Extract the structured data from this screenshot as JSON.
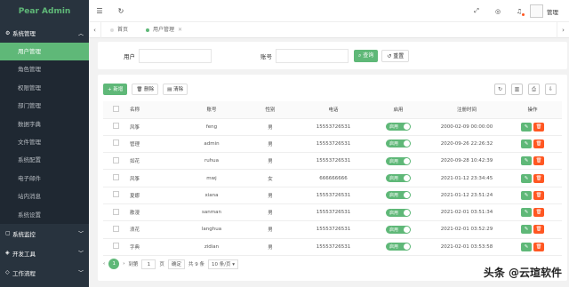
{
  "app": {
    "logo": "Pear Admin"
  },
  "sidebar": {
    "groups": [
      {
        "label": "系统管理",
        "open": true,
        "items": [
          "用户管理",
          "角色管理",
          "权限管理",
          "部门管理",
          "数据字典",
          "文件管理",
          "系统配置",
          "电子邮件",
          "站内消息",
          "系统设置"
        ]
      },
      {
        "label": "系统监控"
      },
      {
        "label": "开发工具"
      },
      {
        "label": "工作流程"
      }
    ],
    "active_item": "用户管理"
  },
  "topbar": {
    "username": "管理"
  },
  "tabs": [
    {
      "label": "首页",
      "active": false
    },
    {
      "label": "用户管理",
      "active": true
    }
  ],
  "search": {
    "user_label": "用户",
    "account_label": "账号",
    "query_button": "查询",
    "reset_button": "重置"
  },
  "toolbar": {
    "add": "新增",
    "delete": "删除",
    "clear": "清除"
  },
  "table": {
    "headers": [
      "名称",
      "账号",
      "性别",
      "电话",
      "启用",
      "注册时间",
      "操作"
    ],
    "rows": [
      [
        "风筝",
        "feng",
        "男",
        "15553726531",
        "启用",
        "2000-02-09 00:00:00"
      ],
      [
        "管理",
        "admin",
        "男",
        "15553726531",
        "启用",
        "2020-09-26 22:26:32"
      ],
      [
        "如花",
        "ruhua",
        "男",
        "15553726531",
        "启用",
        "2020-09-28 10:42:39"
      ],
      [
        "风筝",
        "mwj",
        "女",
        "666666666",
        "启用",
        "2021-01-12 23:34:45"
      ],
      [
        "夏娜",
        "xiana",
        "男",
        "15553726531",
        "启用",
        "2021-01-12 23:51:24"
      ],
      [
        "散漫",
        "sanman",
        "男",
        "15553726531",
        "启用",
        "2021-02-01 03:51:34"
      ],
      [
        "浪花",
        "langhua",
        "男",
        "15553726531",
        "启用",
        "2021-02-01 03:52:29"
      ],
      [
        "字典",
        "zidian",
        "男",
        "15553726531",
        "启用",
        "2021-02-01 03:53:58"
      ]
    ]
  },
  "pager": {
    "current": "1",
    "goto_label": "到第",
    "page_input": "1",
    "page_unit": "页",
    "confirm": "确定",
    "total": "共 9 条",
    "per_page": "10 条/页"
  },
  "watermark": "头条 @云瑄软件",
  "colors": {
    "accent": "#5fb878",
    "danger": "#ff5722",
    "sidebar": "#28333e"
  }
}
